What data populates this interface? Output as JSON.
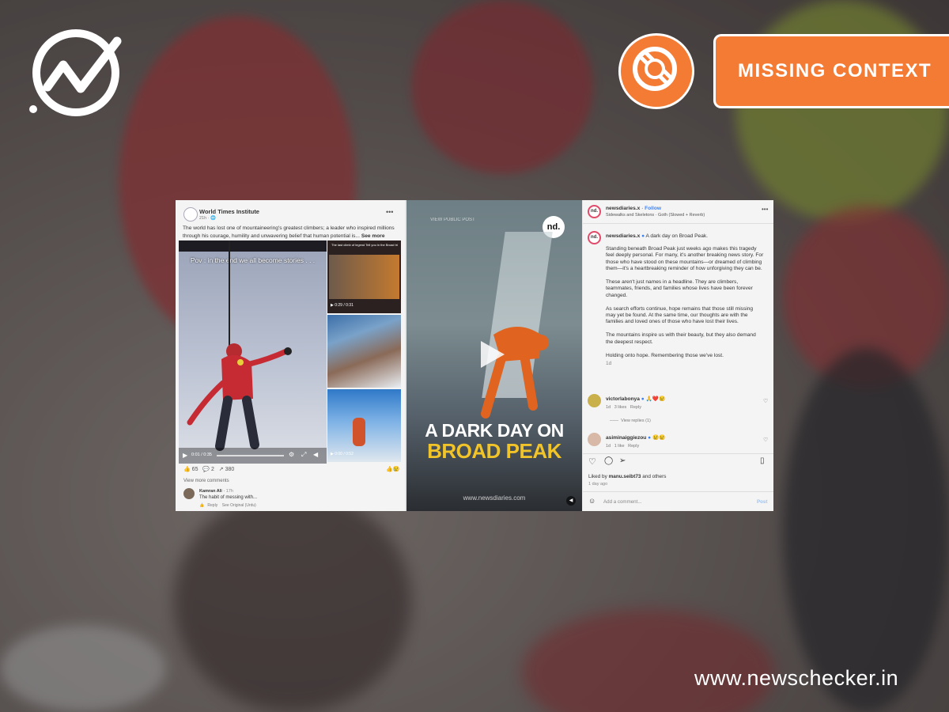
{
  "brand": {
    "site": "www.newschecker.in"
  },
  "rating": {
    "label": "MISSING CONTEXT",
    "accent": "#f47b34"
  },
  "facebook_post": {
    "page_name": "World Times Institute",
    "time": "21h · ",
    "text": "The world has lost one of mountaineering's greatest climbers; a leader who inspired millions through his courage, humility and unwavering belief that human potential is...",
    "see_more": "See more",
    "video_caption": "Pov : in the end we all become stories . . .",
    "video_time_main": "0:01 / 0:35",
    "thumb_caption": "The last climb of legend Tell you in the Broad tri",
    "thumb_time_1": "0:29 / 0:31",
    "thumb_time_2": "0:00 / 0:52",
    "reactions": "65",
    "comments": "2",
    "shares": "380",
    "view_more_comments": "View more comments",
    "comment_author": "Kamran Ali",
    "comment_time": "17h",
    "comment_text": "The habit of messing with...",
    "reply": "Reply",
    "see_original": "See Original (Urdu)"
  },
  "reel": {
    "label": "VIEW PUBLIC POST",
    "logo": "nd.",
    "headline_1": "A DARK DAY ON",
    "headline_2": "BROAD PEAK",
    "url": "www.newsdiaries.com"
  },
  "instagram_post": {
    "account": "newsdiaries.x",
    "follow": "Follow",
    "audio": "Sidewalks and Skeletons · Goth (Slowed + Reverb)",
    "caption_author": "newsdiaries.x",
    "caption_head": "A dark day on Broad Peak.",
    "para_1": "Standing beneath Broad Peak just weeks ago makes this tragedy feel deeply personal. For many, it's another breaking news story. For those who have stood on these mountains—or dreamed of climbing them—it's a heartbreaking reminder of how unforgiving they can be.",
    "para_2": "These aren't just names in a headline. They are climbers, teammates, friends, and families whose lives have been forever changed.",
    "para_3": "As search efforts continue, hope remains that those still missing may yet be found. At the same time, our thoughts are with the families and loved ones of those who have lost their lives.",
    "para_4": "The mountains inspire us with their beauty, but they also demand the deepest respect.",
    "para_5": "Holding onto hope. Remembering those we've lost.",
    "caption_time": "1d",
    "c1_user": "victorlabonya",
    "c1_text": "🙏❤️😢",
    "c1_time": "1d",
    "c1_likes": "3 likes",
    "c1_reply": "Reply",
    "view_replies": "View replies (1)",
    "c2_user": "asiminaiggiezou",
    "c2_text": "😢😢",
    "c2_time": "1d",
    "c2_likes": "1 like",
    "c2_reply": "Reply",
    "liked_by_prefix": "Liked by ",
    "liked_by_user": "manu.seibt73",
    "liked_by_suffix": " and others",
    "post_time": "1 day ago",
    "add_comment": "Add a comment...",
    "post": "Post"
  }
}
